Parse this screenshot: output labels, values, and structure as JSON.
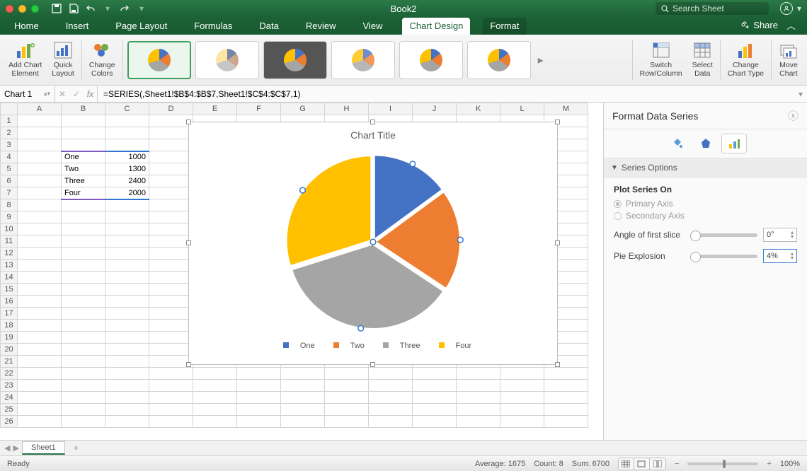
{
  "title": "Book2",
  "search_placeholder": "Search Sheet",
  "tabs": [
    "Home",
    "Insert",
    "Page Layout",
    "Formulas",
    "Data",
    "Review",
    "View",
    "Chart Design",
    "Format"
  ],
  "active_tab": "Chart Design",
  "share_label": "Share",
  "ribbon": {
    "add_chart_element": "Add Chart\nElement",
    "quick_layout": "Quick\nLayout",
    "change_colors": "Change\nColors",
    "switch": "Switch\nRow/Column",
    "select_data": "Select\nData",
    "change_type": "Change\nChart Type",
    "move_chart": "Move\nChart"
  },
  "name_box": "Chart 1",
  "formula": "=SERIES(,Sheet1!$B$4:$B$7,Sheet1!$C$4:$C$7,1)",
  "columns": [
    "A",
    "B",
    "C",
    "D",
    "E",
    "F",
    "G",
    "H",
    "I",
    "J",
    "K",
    "L",
    "M"
  ],
  "cell_b4": "One",
  "cell_b5": "Two",
  "cell_b6": "Three",
  "cell_b7": "Four",
  "cell_c4": "1000",
  "cell_c5": "1300",
  "cell_c6": "2400",
  "cell_c7": "2000",
  "chart_title": "Chart Title",
  "legend": {
    "one": "One",
    "two": "Two",
    "three": "Three",
    "four": "Four"
  },
  "panel": {
    "title": "Format Data Series",
    "section": "Series Options",
    "plot_on": "Plot Series On",
    "primary": "Primary Axis",
    "secondary": "Secondary Axis",
    "angle_label": "Angle of first slice",
    "angle_value": "0°",
    "explosion_label": "Pie Explosion",
    "explosion_value": "4%"
  },
  "sheet_tab": "Sheet1",
  "status": {
    "ready": "Ready",
    "average": "Average: 1675",
    "count": "Count: 8",
    "sum": "Sum: 6700",
    "zoom": "100%"
  },
  "chart_data": {
    "type": "pie",
    "title": "Chart Title",
    "categories": [
      "One",
      "Two",
      "Three",
      "Four"
    ],
    "values": [
      1000,
      1300,
      2400,
      2000
    ],
    "colors": [
      "#4472c4",
      "#ed7d31",
      "#a5a5a5",
      "#ffc000"
    ],
    "explosion_pct": 4,
    "angle_first_slice": 0
  }
}
